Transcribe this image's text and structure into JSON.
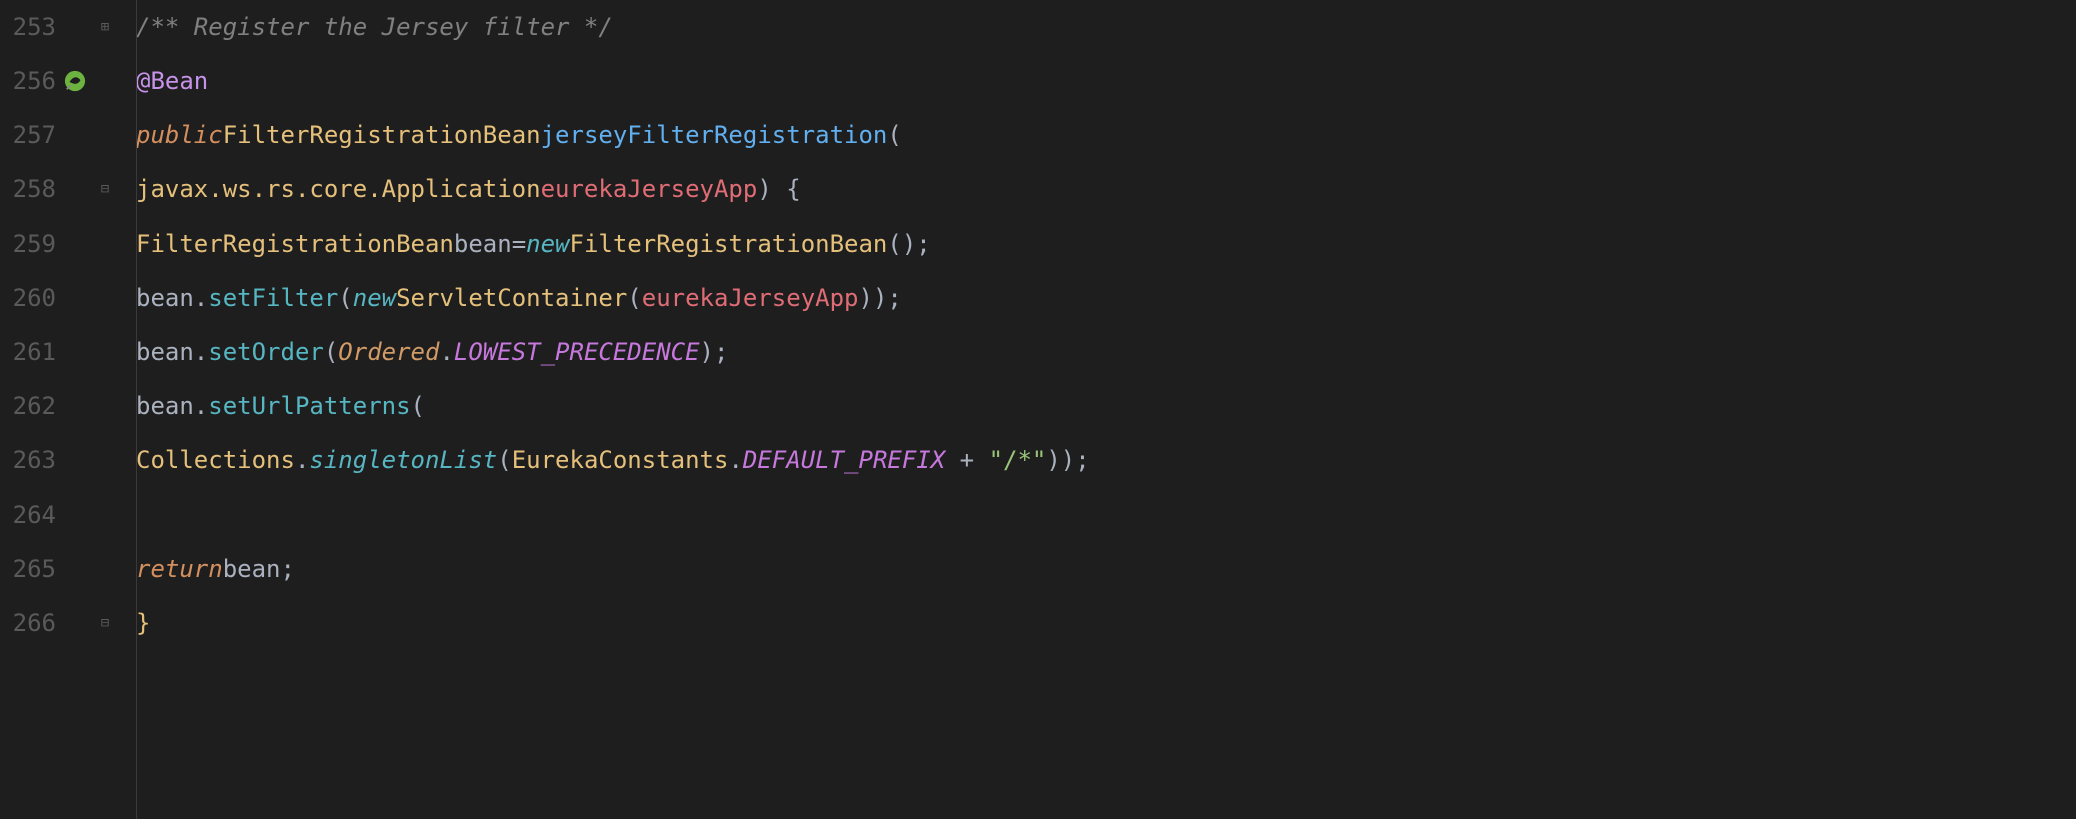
{
  "gutter": {
    "lines": [
      "253",
      "256",
      "257",
      "258",
      "259",
      "260",
      "261",
      "262",
      "263",
      "264",
      "265",
      "266"
    ],
    "bean_icon_line_index": 1,
    "fold_plus_line_index": 0,
    "fold_minus_line_indices": [
      3,
      11
    ]
  },
  "code": {
    "l253": {
      "comment": "/** Register the Jersey filter */"
    },
    "l256": {
      "annotation": "@Bean"
    },
    "l257": {
      "kw_public": "public",
      "type": "FilterRegistrationBean",
      "method": "jerseyFilterRegistration",
      "paren": "("
    },
    "l258": {
      "param_type": "javax.ws.rs.core.Application",
      "param_name": "eurekaJerseyApp",
      "tail": ") {"
    },
    "l259": {
      "type": "FilterRegistrationBean",
      "var": "bean",
      "eq": "=",
      "kw_new": "new",
      "ctor": "FilterRegistrationBean",
      "tail": "();"
    },
    "l260": {
      "var": "bean",
      "dot": ".",
      "method": "setFilter",
      "open": "(",
      "kw_new": "new",
      "ctor": "ServletContainer",
      "open2": "(",
      "arg": "eurekaJerseyApp",
      "tail": "));"
    },
    "l261": {
      "var": "bean",
      "dot": ".",
      "method": "setOrder",
      "open": "(",
      "cls": "Ordered",
      "dot2": ".",
      "const": "LOWEST_PRECEDENCE",
      "tail": ");"
    },
    "l262": {
      "var": "bean",
      "dot": ".",
      "method": "setUrlPatterns",
      "open": "("
    },
    "l263": {
      "cls": "Collections",
      "dot": ".",
      "smethod": "singletonList",
      "open": "(",
      "cls2": "EurekaConstants",
      "dot2": ".",
      "const": "DEFAULT_PREFIX",
      "plus": " + ",
      "str": "\"/*\"",
      "tail": "));"
    },
    "l265": {
      "kw_return": "return",
      "var": "bean",
      "tail": ";"
    },
    "l266": {
      "brace": "}"
    }
  }
}
